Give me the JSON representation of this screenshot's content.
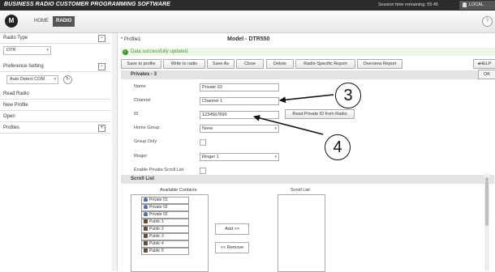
{
  "titlebar": {
    "title": "BUSINESS RADIO CUSTOMER PROGRAMMING SOFTWARE",
    "session": "Session time remaining: 59:45",
    "local": "LOCAL"
  },
  "nav": {
    "logo": "M",
    "home": "HOME",
    "radio": "RADIO",
    "help": "?"
  },
  "sidebar": {
    "radio_type": "Radio Type",
    "radio_type_value": "DTR",
    "preference_setting": "Preference Setting",
    "com_value": "Auto Detect COM",
    "read_radio": "Read Radio",
    "new_profile": "New Profile",
    "open": "Open",
    "profiles": "Profiles",
    "toggle_minus": "−",
    "toggle_plus": "+"
  },
  "main": {
    "profile": "* Profile1",
    "model": "Model - DTR550",
    "status": "Data successfully updated.",
    "toolbar": {
      "save_to_profile": "Save to profile",
      "write_to_radio": "Write to radio",
      "save_as": "Save As",
      "close": "Close",
      "delete": "Delete",
      "radio_specific_report": "Radio-Specific Report",
      "overview_report": "Overview Report",
      "help": "HELP",
      "ok": "OK"
    },
    "section": "Privates - 3",
    "fields": {
      "name_label": "Name",
      "name_value": "Private 03",
      "channel_label": "Channel",
      "channel_value": "Channel 1",
      "id_label": "ID",
      "id_value": "1234567890",
      "home_group_label": "Home Group",
      "home_group_value": "None",
      "group_only_label": "Group Only",
      "ringer_label": "Ringer",
      "ringer_value": "Ringer 1",
      "private_scroll_label": "Enable Private Scroll List"
    },
    "read_private_id": "Read Private ID from Radio",
    "scroll_list_header": "Scroll List",
    "available_contacts": "Available Contacts",
    "scroll_list": "Scroll List",
    "contacts": [
      "Private 01",
      "Private 02",
      "Private 03",
      "Public 1",
      "Public 2",
      "Public 3",
      "Public 4",
      "Public 5"
    ],
    "add_btn": "Add >>",
    "remove_btn": "<< Remove"
  },
  "callouts": {
    "three": "3",
    "four": "4"
  }
}
